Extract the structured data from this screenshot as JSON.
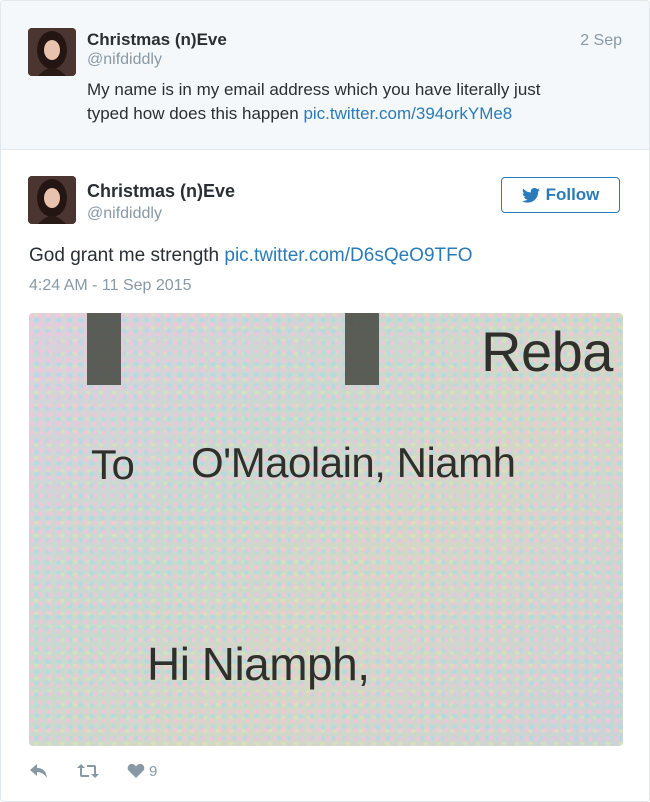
{
  "parent_tweet": {
    "author_name": "Christmas (n)Eve",
    "author_handle": "@nifdiddly",
    "date": "2 Sep",
    "text_line1": "My name is in my email address which you have literally just",
    "text_line2": "typed how does this happen",
    "link": "pic.twitter.com/394orkYMe8"
  },
  "main_tweet": {
    "author_name": "Christmas (n)Eve",
    "author_handle": "@nifdiddly",
    "follow_label": "Follow",
    "text": "God grant me strength",
    "link": "pic.twitter.com/D6sQeO9TFO",
    "timestamp": "4:24 AM - 11 Sep 2015",
    "photo": {
      "top_right": "Reba",
      "to_label": "To",
      "to_name": "O'Maolain, Niamh",
      "greeting": "Hi Niamph,"
    },
    "actions": {
      "reply_icon": "reply-icon",
      "retweet_icon": "retweet-icon",
      "like_icon": "heart-icon",
      "like_count": "9"
    }
  },
  "colors": {
    "link": "#2b7bb9",
    "muted": "#8899a6",
    "text": "#292f33",
    "parent_bg": "#f5f8fa"
  }
}
